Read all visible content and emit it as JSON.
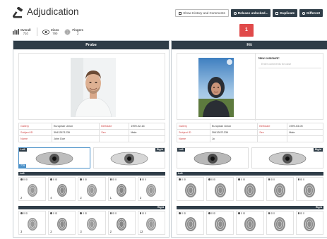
{
  "header": {
    "title": "Adjudication",
    "buttons": {
      "show_history": "Show History and Comments",
      "release": "Release unlocked...",
      "duplicate": "Duplicate",
      "different": "Different"
    }
  },
  "stats": [
    {
      "label": "Overall",
      "value": "710",
      "icon": "bar-chart-icon"
    },
    {
      "label": "Irises",
      "value": "790",
      "icon": "eye-icon"
    },
    {
      "label": "Fingers",
      "value": "2",
      "icon": "fingerprint-icon"
    }
  ],
  "badge": "1",
  "probe": {
    "header": "Probe",
    "info": [
      [
        "Gallery",
        "European Union",
        "Birthdate",
        "1999-02-16"
      ],
      [
        "Subject ID",
        "39412871239",
        "Sex",
        "Male"
      ],
      [
        "Name",
        "John Doe",
        "",
        ""
      ]
    ],
    "iris_left_label": "Left",
    "iris_right_label": "Right",
    "iris_left_score": "779",
    "fingers_left_label": "Left",
    "fingers_right_label": "Right",
    "fingers_left": [
      "2",
      "4",
      "2",
      "1",
      "3"
    ],
    "fingers_right": [
      "3",
      "2",
      "3",
      "2",
      "12"
    ]
  },
  "hit": {
    "header": "Hit",
    "comment_title": "New comment:",
    "comment_placeholder": "Enter comments for case",
    "info": [
      [
        "Gallery",
        "European Union",
        "Birthdate",
        "1999-03-05"
      ],
      [
        "Subject ID",
        "39412871239",
        "Sex",
        "Male"
      ],
      [
        "Name",
        "Jo",
        "",
        ""
      ]
    ],
    "iris_left_label": "Left",
    "iris_right_label": "Right",
    "fingers_left_label": "Left",
    "fingers_right_label": "Right"
  },
  "colors": {
    "header_bar": "#2f3d48",
    "accent_blue": "#4a90c8",
    "badge_red": "#e04a4a",
    "field_red": "#d04545"
  }
}
